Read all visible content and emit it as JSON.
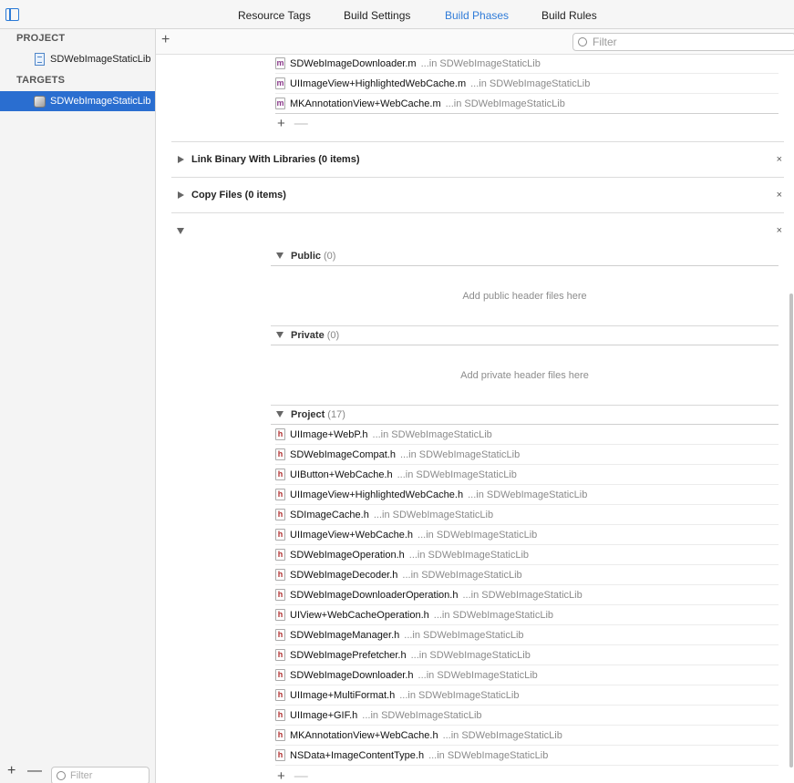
{
  "tabs": [
    {
      "label": "Resource Tags",
      "active": false
    },
    {
      "label": "Build Settings",
      "active": false
    },
    {
      "label": "Build Phases",
      "active": true
    },
    {
      "label": "Build Rules",
      "active": false
    }
  ],
  "sidebar": {
    "project_section": "PROJECT",
    "project_item": "SDWebImageStaticLib",
    "targets_section": "TARGETS",
    "target_item": "SDWebImageStaticLib",
    "filter_placeholder": "Filter"
  },
  "toolbar": {
    "add_symbol": "+",
    "filter_placeholder": "Filter"
  },
  "compile_sources_tail": [
    {
      "name": "SDWebImageDownloader.m",
      "location": "...in SDWebImageStaticLib"
    },
    {
      "name": "UIImageView+HighlightedWebCache.m",
      "location": "...in SDWebImageStaticLib"
    },
    {
      "name": "MKAnnotationView+WebCache.m",
      "location": "...in SDWebImageStaticLib"
    }
  ],
  "phases": {
    "link_binary": "Link Binary With Libraries (0 items)",
    "copy_files": "Copy Files (0 items)",
    "close_symbol": "×"
  },
  "headers": {
    "public": {
      "title": "Public",
      "count": "(0)",
      "placeholder": "Add public header files here"
    },
    "private": {
      "title": "Private",
      "count": "(0)",
      "placeholder": "Add private header files here"
    },
    "project": {
      "title": "Project",
      "count": "(17)"
    },
    "project_files": [
      {
        "name": "UIImage+WebP.h",
        "location": "...in SDWebImageStaticLib"
      },
      {
        "name": "SDWebImageCompat.h",
        "location": "...in SDWebImageStaticLib"
      },
      {
        "name": "UIButton+WebCache.h",
        "location": "...in SDWebImageStaticLib"
      },
      {
        "name": "UIImageView+HighlightedWebCache.h",
        "location": "...in SDWebImageStaticLib"
      },
      {
        "name": "SDImageCache.h",
        "location": "...in SDWebImageStaticLib"
      },
      {
        "name": "UIImageView+WebCache.h",
        "location": "...in SDWebImageStaticLib"
      },
      {
        "name": "SDWebImageOperation.h",
        "location": "...in SDWebImageStaticLib"
      },
      {
        "name": "SDWebImageDecoder.h",
        "location": "...in SDWebImageStaticLib"
      },
      {
        "name": "SDWebImageDownloaderOperation.h",
        "location": "...in SDWebImageStaticLib"
      },
      {
        "name": "UIView+WebCacheOperation.h",
        "location": "...in SDWebImageStaticLib"
      },
      {
        "name": "SDWebImageManager.h",
        "location": "...in SDWebImageStaticLib"
      },
      {
        "name": "SDWebImagePrefetcher.h",
        "location": "...in SDWebImageStaticLib"
      },
      {
        "name": "SDWebImageDownloader.h",
        "location": "...in SDWebImageStaticLib"
      },
      {
        "name": "UIImage+MultiFormat.h",
        "location": "...in SDWebImageStaticLib"
      },
      {
        "name": "UIImage+GIF.h",
        "location": "...in SDWebImageStaticLib"
      },
      {
        "name": "MKAnnotationView+WebCache.h",
        "location": "...in SDWebImageStaticLib"
      },
      {
        "name": "NSData+ImageContentType.h",
        "location": "...in SDWebImageStaticLib"
      }
    ]
  },
  "icons": {
    "m_file": "m",
    "h_file": "h",
    "plus": "+",
    "minus": "—"
  },
  "colors": {
    "accent": "#2f7bd8",
    "selection": "#2a6ed0"
  }
}
